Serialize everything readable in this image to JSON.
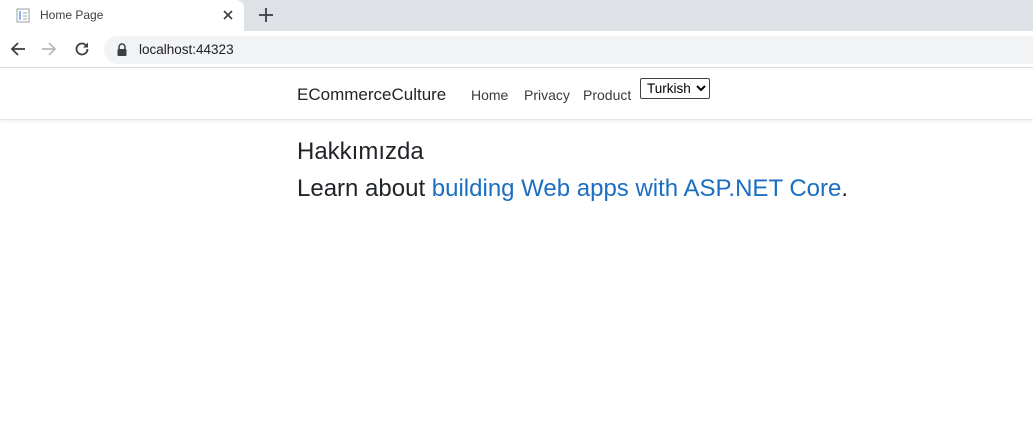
{
  "browser": {
    "tab_title": "Home Page",
    "url": "localhost:44323",
    "icons": {
      "favicon": "page-icon",
      "close": "close-icon",
      "new_tab": "plus-icon",
      "back": "arrow-left-icon",
      "forward": "arrow-right-icon",
      "reload": "reload-icon",
      "lock": "lock-icon"
    }
  },
  "header": {
    "brand": "ECommerceCulture",
    "nav": [
      "Home",
      "Privacy",
      "Product"
    ],
    "language_select": {
      "selected": "Turkish"
    }
  },
  "main": {
    "title": "Hakkımızda",
    "lead_prefix": "Learn about ",
    "lead_link": "building Web apps with ASP.NET Core",
    "lead_suffix": "."
  },
  "colors": {
    "link": "#1b6ec2",
    "text": "#212529",
    "tabstrip": "#dee1e6"
  }
}
